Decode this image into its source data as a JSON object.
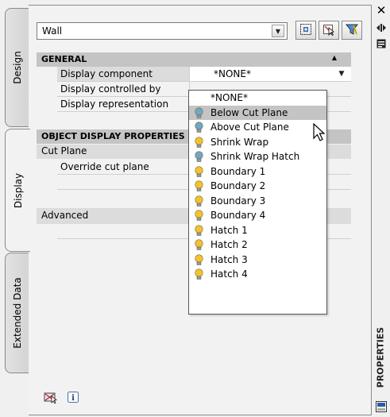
{
  "tabs": [
    {
      "label": "Design"
    },
    {
      "label": "Display"
    },
    {
      "label": "Extended Data"
    }
  ],
  "style_select": {
    "value": "Wall"
  },
  "toolbar": {
    "icons": [
      "add-selected-icon",
      "quick-select-icon",
      "filter-icon"
    ]
  },
  "grid": {
    "general": {
      "title": "GENERAL",
      "rows": [
        {
          "label": "Display component",
          "value": "*NONE*"
        },
        {
          "label": "Display controlled by",
          "value": ""
        },
        {
          "label": "Display representation",
          "value": ""
        }
      ]
    },
    "object_display": {
      "title": "OBJECT DISPLAY PROPERTIES",
      "cut_plane": {
        "title": "Cut Plane",
        "rows": [
          {
            "label": "Override cut plane",
            "value": ""
          }
        ]
      },
      "advanced": {
        "title": "Advanced"
      }
    }
  },
  "dropdown": {
    "selected": "Below Cut Plane",
    "options": [
      {
        "label": "*NONE*",
        "bulb": "none"
      },
      {
        "label": "Below Cut Plane",
        "bulb": "blue"
      },
      {
        "label": "Above Cut Plane",
        "bulb": "blue"
      },
      {
        "label": "Shrink Wrap",
        "bulb": "yellow"
      },
      {
        "label": "Shrink Wrap Hatch",
        "bulb": "blue"
      },
      {
        "label": "Boundary 1",
        "bulb": "yellow"
      },
      {
        "label": "Boundary 2",
        "bulb": "yellow"
      },
      {
        "label": "Boundary 3",
        "bulb": "yellow"
      },
      {
        "label": "Boundary 4",
        "bulb": "yellow"
      },
      {
        "label": "Hatch 1",
        "bulb": "yellow"
      },
      {
        "label": "Hatch 2",
        "bulb": "yellow"
      },
      {
        "label": "Hatch 3",
        "bulb": "yellow"
      },
      {
        "label": "Hatch 4",
        "bulb": "yellow"
      }
    ]
  },
  "palette_title": "PROPERTIES",
  "colors": {
    "bulb_yellow": "#f2c230",
    "bulb_blue": "#6fa6c9",
    "category_bg": "#c4c4c4"
  }
}
